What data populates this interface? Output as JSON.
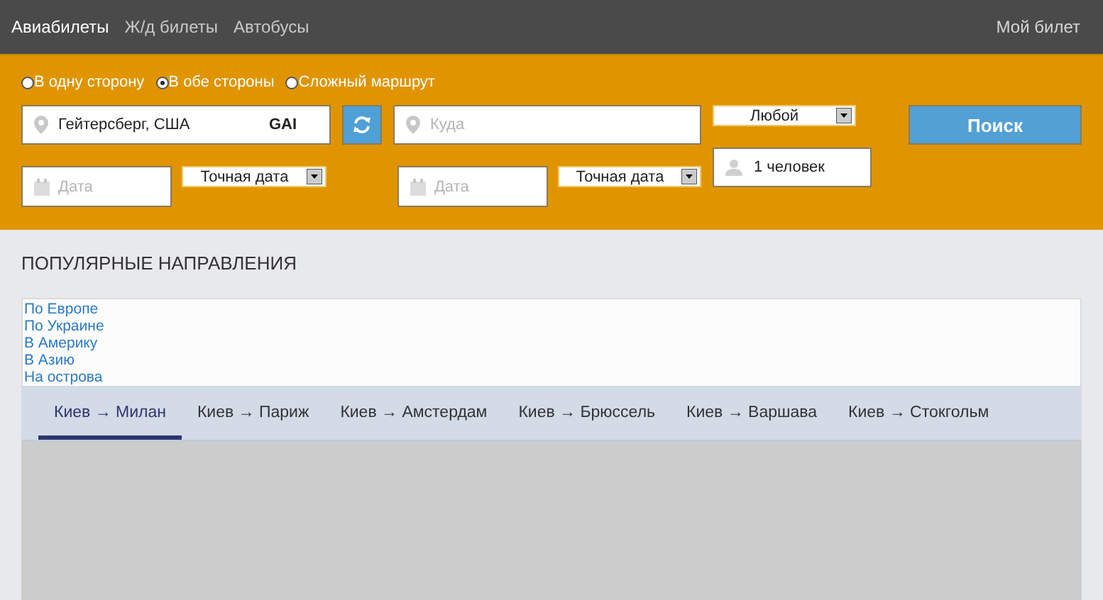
{
  "top_nav": {
    "links": [
      {
        "label": "Авиабилеты",
        "selected": true
      },
      {
        "label": "Ж/д билеты",
        "selected": false
      },
      {
        "label": "Автобусы",
        "selected": false
      }
    ],
    "account_link": "Мой билет"
  },
  "search_form": {
    "trip_types": [
      {
        "label": "В одну сторону",
        "selected": false
      },
      {
        "label": "В обе стороны",
        "selected": true
      },
      {
        "label": "Сложный маршрут",
        "selected": false
      }
    ],
    "origin": {
      "value": "Гейтерсберг, США",
      "code": "GAI"
    },
    "destination": {
      "placeholder": "Куда"
    },
    "class_select": "Любой",
    "search_button": "Поиск",
    "depart_date": {
      "placeholder": "Дата"
    },
    "depart_date_mode": "Точная дата",
    "return_date": {
      "placeholder": "Дата"
    },
    "return_date_mode": "Точная дата",
    "passengers": "1 человек"
  },
  "popular": {
    "title": "ПОПУЛЯРНЫЕ НАПРАВЛЕНИЯ",
    "regions": [
      "По Европе",
      "По Украине",
      "В Америку",
      "В Азию",
      "На острова"
    ],
    "tabs": [
      {
        "label": "Киев → Милан",
        "selected": true
      },
      {
        "label": "Киев → Париж",
        "selected": false
      },
      {
        "label": "Киев → Амстердам",
        "selected": false
      },
      {
        "label": "Киев → Брюссель",
        "selected": false
      },
      {
        "label": "Киев → Варшава",
        "selected": false
      },
      {
        "label": "Киев → Стокгольм",
        "selected": false
      }
    ]
  }
}
